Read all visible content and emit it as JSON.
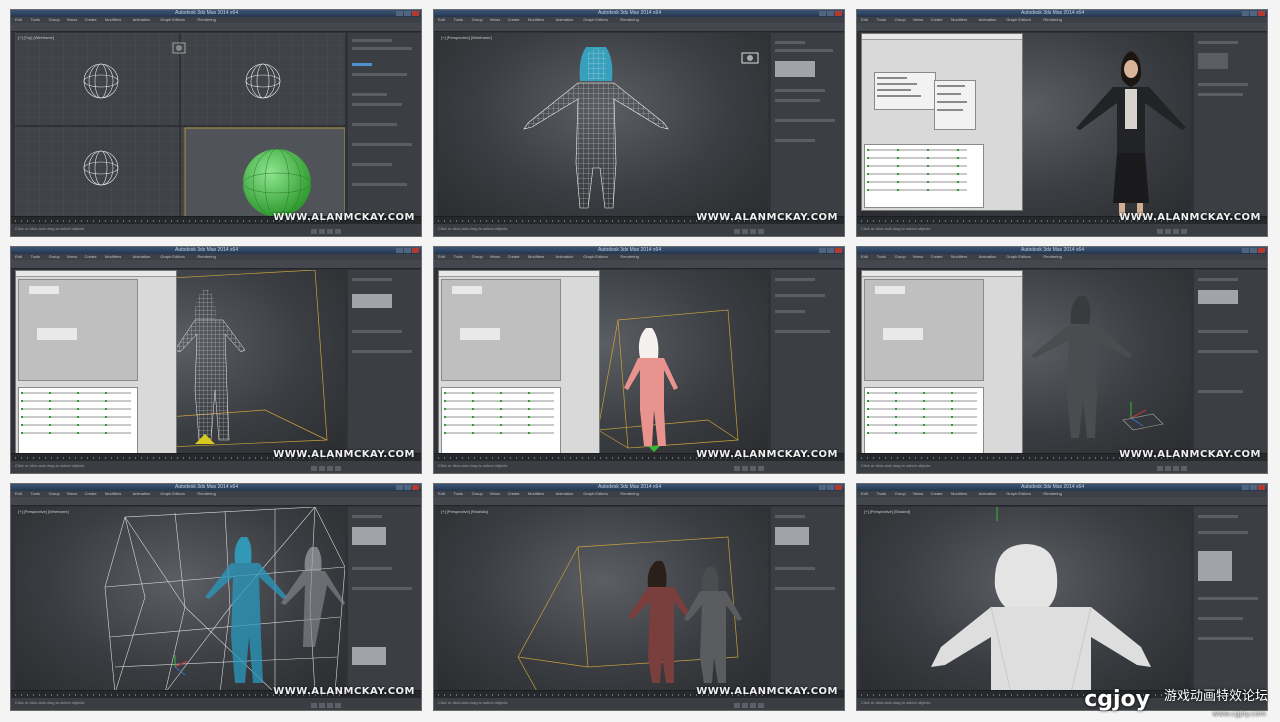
{
  "watermark": "WWW.ALANMCKAY.COM",
  "app": {
    "title": "Autodesk 3ds Max 2014 x64"
  },
  "menu": [
    "Edit",
    "Tools",
    "Group",
    "Views",
    "Create",
    "Modifiers",
    "Animation",
    "Graph Editors",
    "Rendering"
  ],
  "status": {
    "text": "Click or click-and-drag to select objects"
  },
  "viewports": [
    {
      "label": "[+] [Top] [Wireframe]"
    },
    {
      "label": "[+] [Perspective] [Wireframe]"
    },
    {
      "label": "[+] [Perspective] [Realistic]"
    },
    {
      "label": "[+] [Perspective] [Wireframe]"
    },
    {
      "label": "[+] [Perspective] [Realistic]"
    },
    {
      "label": "[+] [Perspective] [Shaded]"
    },
    {
      "label": "[+] [Perspective] [Wireframe]"
    },
    {
      "label": "[+] [Perspective] [Realistic]"
    },
    {
      "label": "[+] [Perspective] [Shaded]"
    }
  ],
  "footer": {
    "logo": "cgjoy",
    "chinese": "游戏动画特效论坛",
    "url": "www.cgjoy.com"
  },
  "colors": {
    "frame_bg": "#2f3236",
    "title_bar": "#2c4363",
    "accent_green": "#3ab53a"
  }
}
